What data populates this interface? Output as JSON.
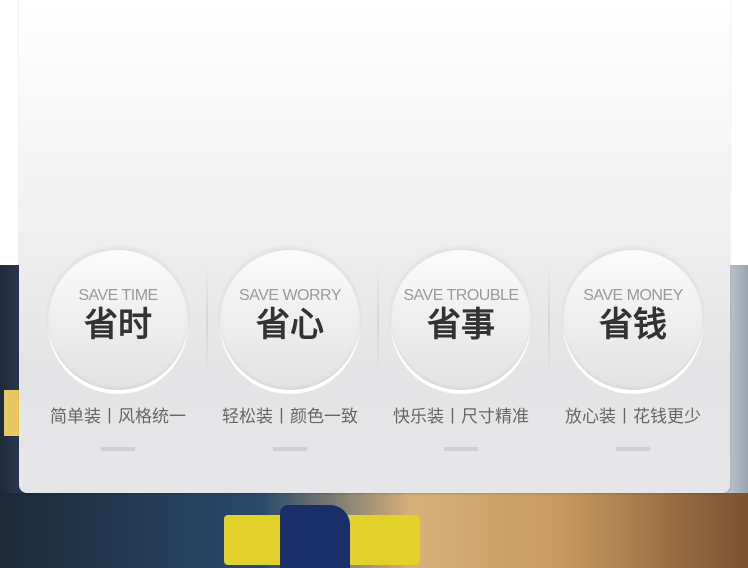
{
  "features": [
    {
      "en": "SAVE TIME",
      "cn": "省时",
      "sub": "简单装丨风格统一"
    },
    {
      "en": "SAVE WORRY",
      "cn": "省心",
      "sub": "轻松装丨颜色一致"
    },
    {
      "en": "SAVE TROUBLE",
      "cn": "省事",
      "sub": "快乐装丨尺寸精准"
    },
    {
      "en": "SAVE MONEY",
      "cn": "省钱",
      "sub": "放心装丨花钱更少"
    }
  ]
}
